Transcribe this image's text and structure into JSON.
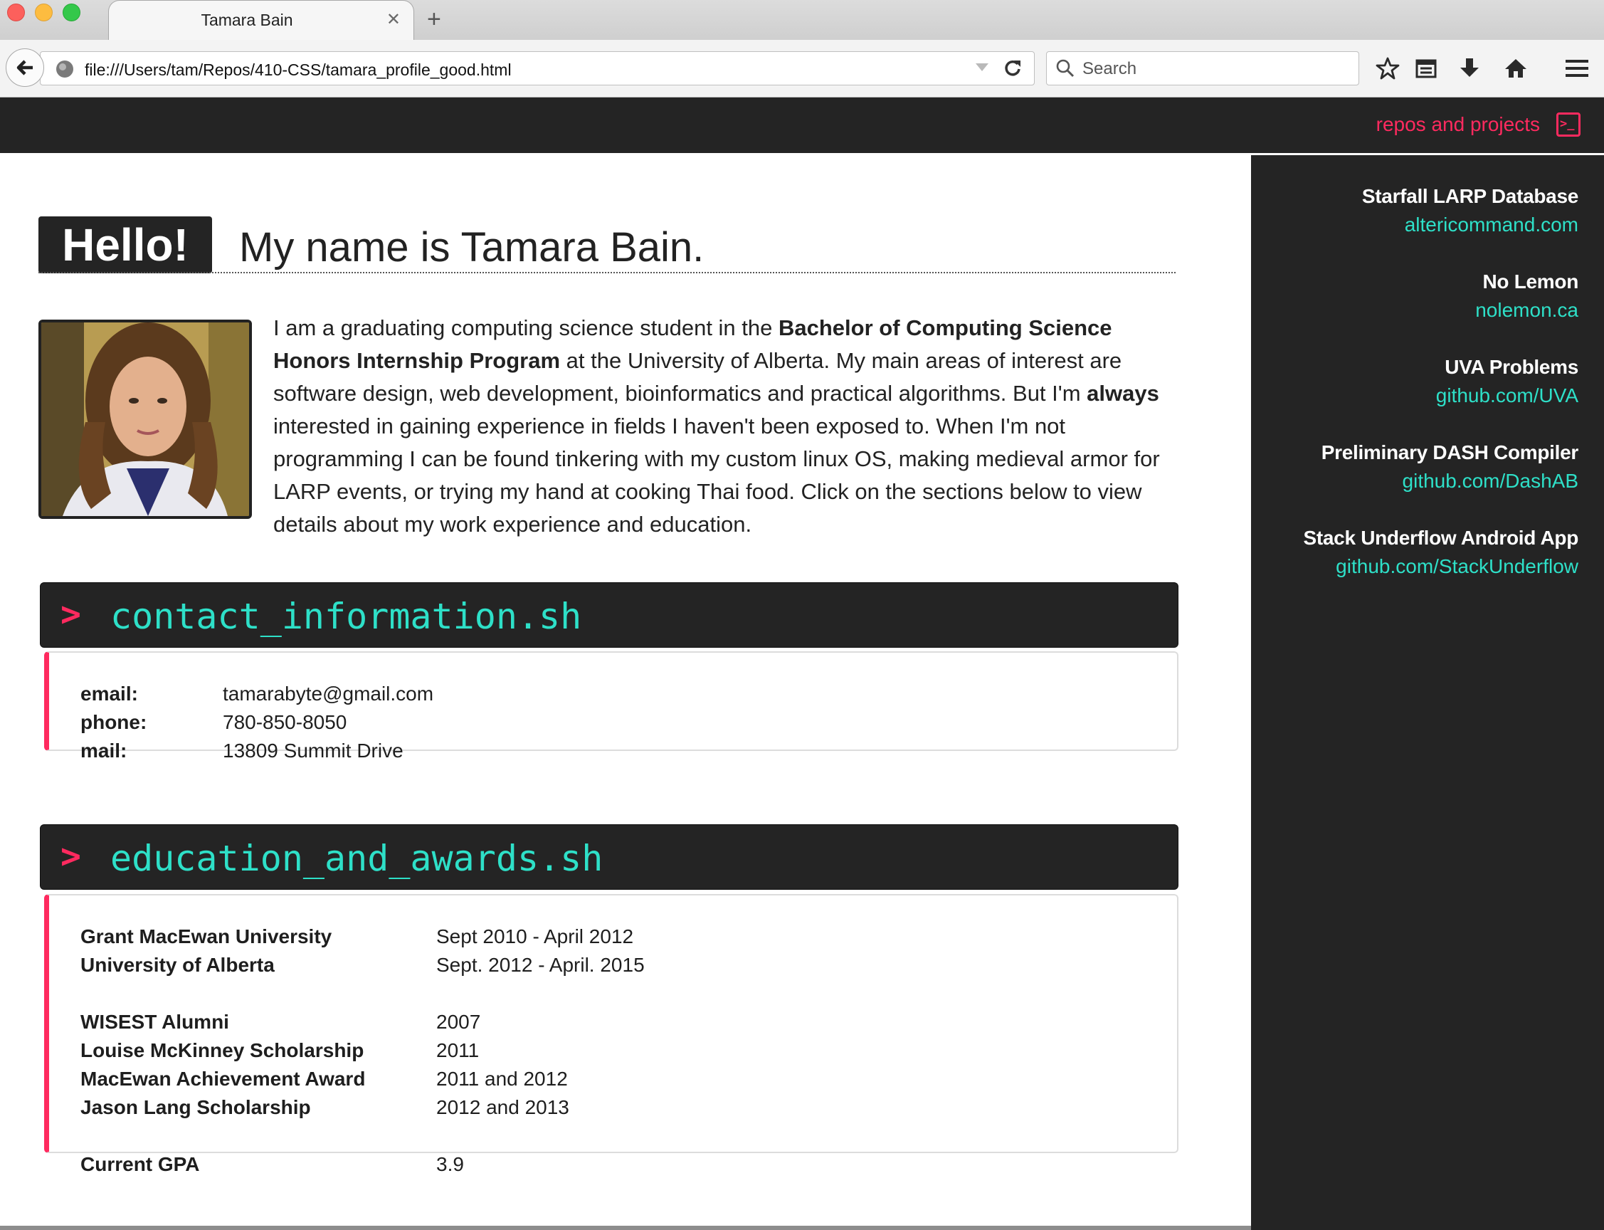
{
  "browser": {
    "tab_title": "Tamara Bain",
    "tab_close": "✕",
    "new_tab": "+",
    "url": "file:///Users/tam/Repos/410-CSS/tamara_profile_good.html",
    "search_placeholder": "Search"
  },
  "colors": {
    "accent_pink": "#ff2a5f",
    "accent_teal": "#2ee0c8",
    "dark": "#242424"
  },
  "topnav": {
    "link": "repos and projects",
    "link_icon": "terminal-icon",
    "terminal_glyph": ">_"
  },
  "sidebar": {
    "projects": [
      {
        "name": "Starfall LARP Database",
        "link": "altericommand.com"
      },
      {
        "name": "No Lemon",
        "link": "nolemon.ca"
      },
      {
        "name": "UVA Problems",
        "link": "github.com/UVA"
      },
      {
        "name": "Preliminary DASH Compiler",
        "link": "github.com/DashAB"
      },
      {
        "name": "Stack Underflow Android App",
        "link": "github.com/StackUnderflow"
      }
    ]
  },
  "intro": {
    "hello": "Hello!",
    "heading": "My name is Tamara Bain.",
    "bio_1": "I am a graduating computing science student in the ",
    "bio_2": "Bachelor of Computing Science Honors Internship Program",
    "bio_3": " at the University of Alberta. My main areas of interest are software design, web development, bioinformatics and practical algorithms. But I'm ",
    "bio_4": "always",
    "bio_5": " interested in gaining experience in fields I haven't been exposed to. When I'm not programming I can be found tinkering with my custom linux OS, making medieval armor for LARP events, or trying my hand at cooking Thai food. Click on the sections below to view details about my work experience and education."
  },
  "contact": {
    "prompt": ">",
    "title": "contact_information.sh",
    "rows": [
      {
        "label": "email:",
        "value": "tamarabyte@gmail.com"
      },
      {
        "label": "phone:",
        "value": "780-850-8050"
      },
      {
        "label": "mail:",
        "value": "13809 Summit Drive"
      }
    ]
  },
  "education": {
    "prompt": ">",
    "title": "education_and_awards.sh",
    "schools": [
      {
        "label": "Grant MacEwan University",
        "value": "Sept 2010 - April 2012"
      },
      {
        "label": "University of Alberta",
        "value": "Sept. 2012 - April. 2015"
      }
    ],
    "awards": [
      {
        "label": "WISEST Alumni",
        "value": "2007"
      },
      {
        "label": "Louise McKinney Scholarship",
        "value": "2011"
      },
      {
        "label": "MacEwan Achievement Award",
        "value": "2011 and 2012"
      },
      {
        "label": "Jason Lang Scholarship",
        "value": "2012 and 2013"
      }
    ],
    "gpa": {
      "label": "Current GPA",
      "value": "3.9"
    }
  }
}
